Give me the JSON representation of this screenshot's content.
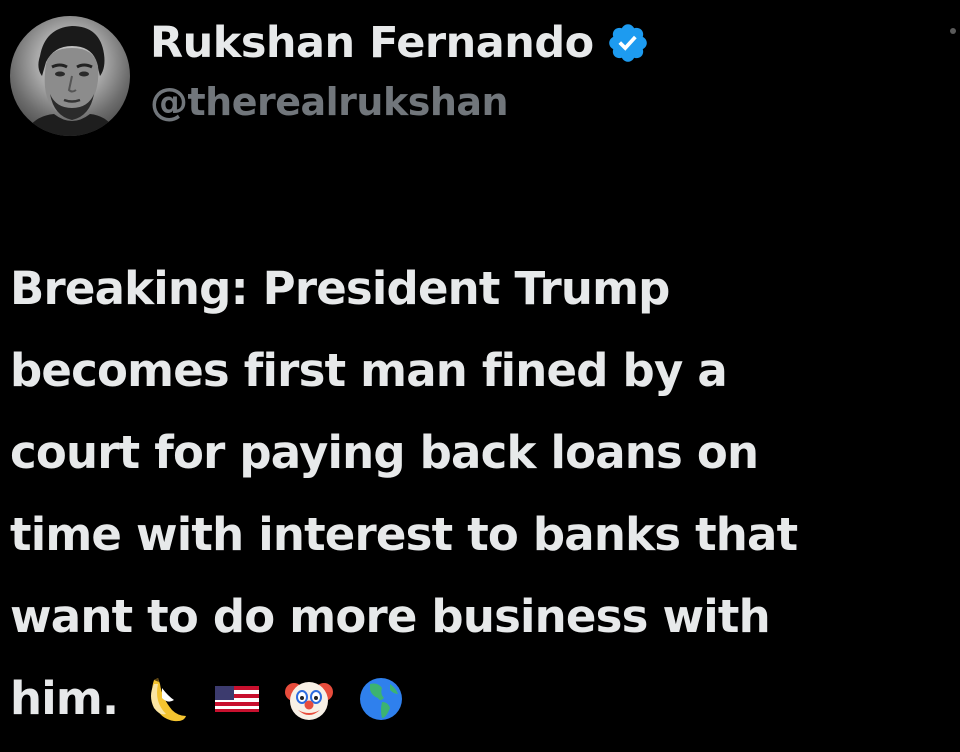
{
  "author": {
    "display_name": "Rukshan Fernando",
    "handle": "@therealrukshan",
    "verified": true,
    "verified_icon": "verified-badge-icon",
    "verified_color": "#1d9bf0"
  },
  "tweet": {
    "lines": [
      "Breaking: President Trump",
      "becomes first man fined by a",
      "court for paying back loans on",
      "time with interest to banks that",
      "want to do more business with",
      "him."
    ],
    "emojis": [
      "banana-emoji",
      "us-flag-emoji",
      "clown-face-emoji",
      "globe-americas-emoji"
    ]
  },
  "colors": {
    "background": "#000000",
    "text": "#e7e9ea",
    "handle": "#71767b"
  }
}
